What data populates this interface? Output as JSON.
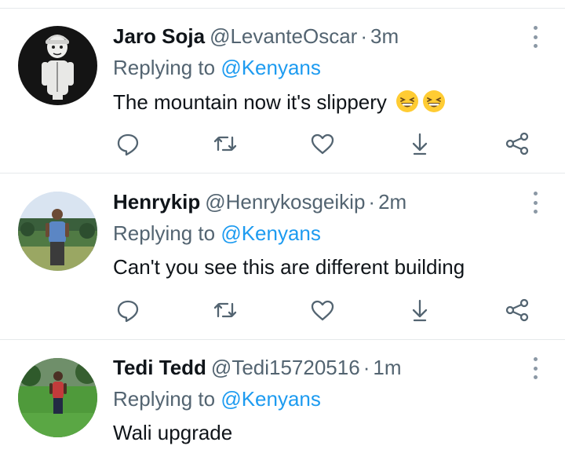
{
  "tweets": [
    {
      "name": "Jaro Soja",
      "handle": "@LevanteOscar",
      "separator": "·",
      "time": "3m",
      "replying_prefix": "Replying to",
      "replying_to": "@Kenyans",
      "text": "The mountain now it's slippery",
      "emojis": [
        "grinning-squinting-face-emoji",
        "grinning-squinting-face-emoji"
      ],
      "avatar": "cartoon-boy-avatar"
    },
    {
      "name": "Henrykip",
      "handle": "@Henrykosgeikip",
      "separator": "·",
      "time": "2m",
      "replying_prefix": "Replying to",
      "replying_to": "@Kenyans",
      "text": "Can't you see this are different building",
      "avatar": "man-in-field-avatar"
    },
    {
      "name": "Tedi Tedd",
      "handle": "@Tedi15720516",
      "separator": "·",
      "time": "1m",
      "replying_prefix": "Replying to",
      "replying_to": "@Kenyans",
      "text": "Wali upgrade",
      "avatar": "man-on-lawn-avatar"
    }
  ],
  "action_icons": [
    "reply-icon",
    "retweet-icon",
    "like-icon",
    "download-icon",
    "share-icon"
  ],
  "colors": {
    "accent": "#1d9bf0",
    "secondary_text": "#536471",
    "primary_text": "#0f1419",
    "divider": "#e6e9eb"
  }
}
